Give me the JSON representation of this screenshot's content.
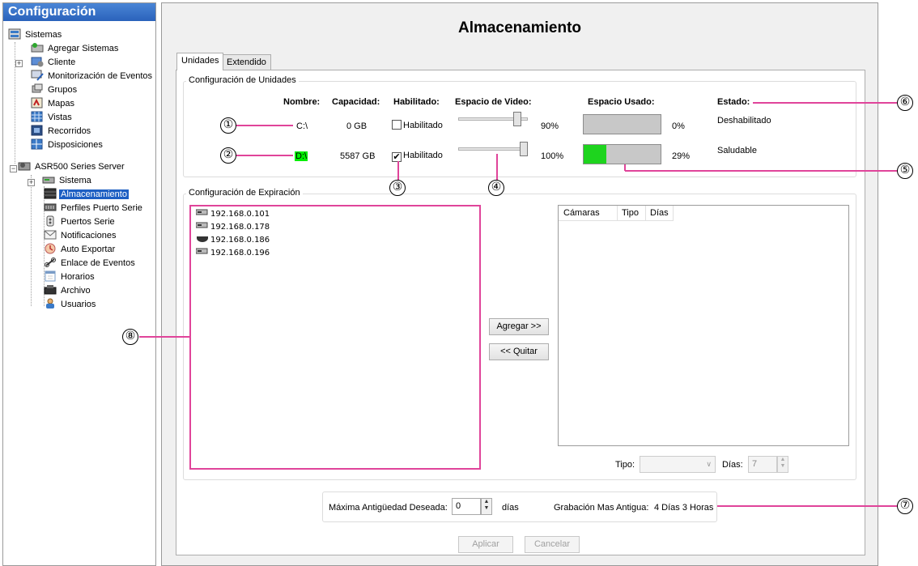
{
  "sidebar": {
    "title": "Configuración",
    "items": [
      {
        "label": "Sistemas",
        "icon": "systems-icon"
      },
      {
        "label": "Agregar Sistemas",
        "icon": "add-system-icon"
      },
      {
        "label": "Cliente",
        "icon": "client-icon"
      },
      {
        "label": "Monitorización de Eventos",
        "icon": "event-monitor-icon"
      },
      {
        "label": "Grupos",
        "icon": "groups-icon"
      },
      {
        "label": "Mapas",
        "icon": "maps-icon"
      },
      {
        "label": "Vistas",
        "icon": "views-icon"
      },
      {
        "label": "Recorridos",
        "icon": "tours-icon"
      },
      {
        "label": "Disposiciones",
        "icon": "layouts-icon"
      },
      {
        "label": "ASR500 Series Server",
        "icon": "server-icon"
      },
      {
        "label": "Sistema",
        "icon": "system-icon"
      },
      {
        "label": "Almacenamiento",
        "icon": "storage-icon",
        "selected": true
      },
      {
        "label": "Perfiles Puerto Serie",
        "icon": "serial-profile-icon"
      },
      {
        "label": "Puertos Serie",
        "icon": "serial-port-icon"
      },
      {
        "label": "Notificaciones",
        "icon": "notifications-icon"
      },
      {
        "label": "Auto Exportar",
        "icon": "auto-export-icon"
      },
      {
        "label": "Enlace de Eventos",
        "icon": "event-link-icon"
      },
      {
        "label": "Horarios",
        "icon": "schedule-icon"
      },
      {
        "label": "Archivo",
        "icon": "archive-icon"
      },
      {
        "label": "Usuarios",
        "icon": "users-icon"
      }
    ]
  },
  "main": {
    "title": "Almacenamiento",
    "tabs": [
      {
        "label": "Unidades",
        "active": true
      },
      {
        "label": "Extendido",
        "active": false
      }
    ],
    "units_group": {
      "title": "Configuración de Unidades",
      "headers": {
        "name": "Nombre:",
        "capacity": "Capacidad:",
        "enabled": "Habilitado:",
        "video_space": "Espacio de Video:",
        "used_space": "Espacio Usado:",
        "status": "Estado:"
      },
      "drives": [
        {
          "name": "C:\\",
          "capacity": "0 GB",
          "enabled": false,
          "enabled_label": "Habilitado",
          "video_percent_label": "90%",
          "video_fraction": 0.9,
          "used_label": "0%",
          "used_fraction": 0.0,
          "status": "Deshabilitado"
        },
        {
          "name": "D:\\",
          "capacity": "5587 GB",
          "enabled": true,
          "enabled_label": "Habilitado",
          "video_percent_label": "100%",
          "video_fraction": 1.0,
          "used_label": "29%",
          "used_fraction": 0.29,
          "status": "Saludable"
        }
      ]
    },
    "expiration_group": {
      "title": "Configuración de Expiración",
      "cameras": [
        {
          "ip": "192.168.0.101",
          "icon": "encoder-icon"
        },
        {
          "ip": "192.168.0.178",
          "icon": "encoder-icon"
        },
        {
          "ip": "192.168.0.186",
          "icon": "dome-camera-icon"
        },
        {
          "ip": "192.168.0.196",
          "icon": "encoder-icon"
        }
      ],
      "add_button": "Agregar >>",
      "remove_button": "<< Quitar",
      "columns": [
        "Cámaras",
        "Tipo",
        "Días"
      ],
      "type_label": "Tipo:",
      "type_value": "",
      "days_label": "Días:",
      "days_value": "7"
    },
    "retention": {
      "max_age_label": "Máxima Antigüedad Deseada:",
      "max_age_value": "0",
      "days_unit": "días",
      "oldest_label": "Grabación Mas Antigua:",
      "oldest_value": "4 Días 3 Horas"
    },
    "apply_button": "Aplicar",
    "cancel_button": "Cancelar"
  },
  "callouts": [
    "①",
    "②",
    "③",
    "④",
    "⑤",
    "⑥",
    "⑦",
    "⑧"
  ],
  "colors": {
    "accent": "#1d5fc3",
    "annotation": "#e0449a",
    "usage_fill": "#1ed41e",
    "header_blue": "#2a62bb"
  }
}
